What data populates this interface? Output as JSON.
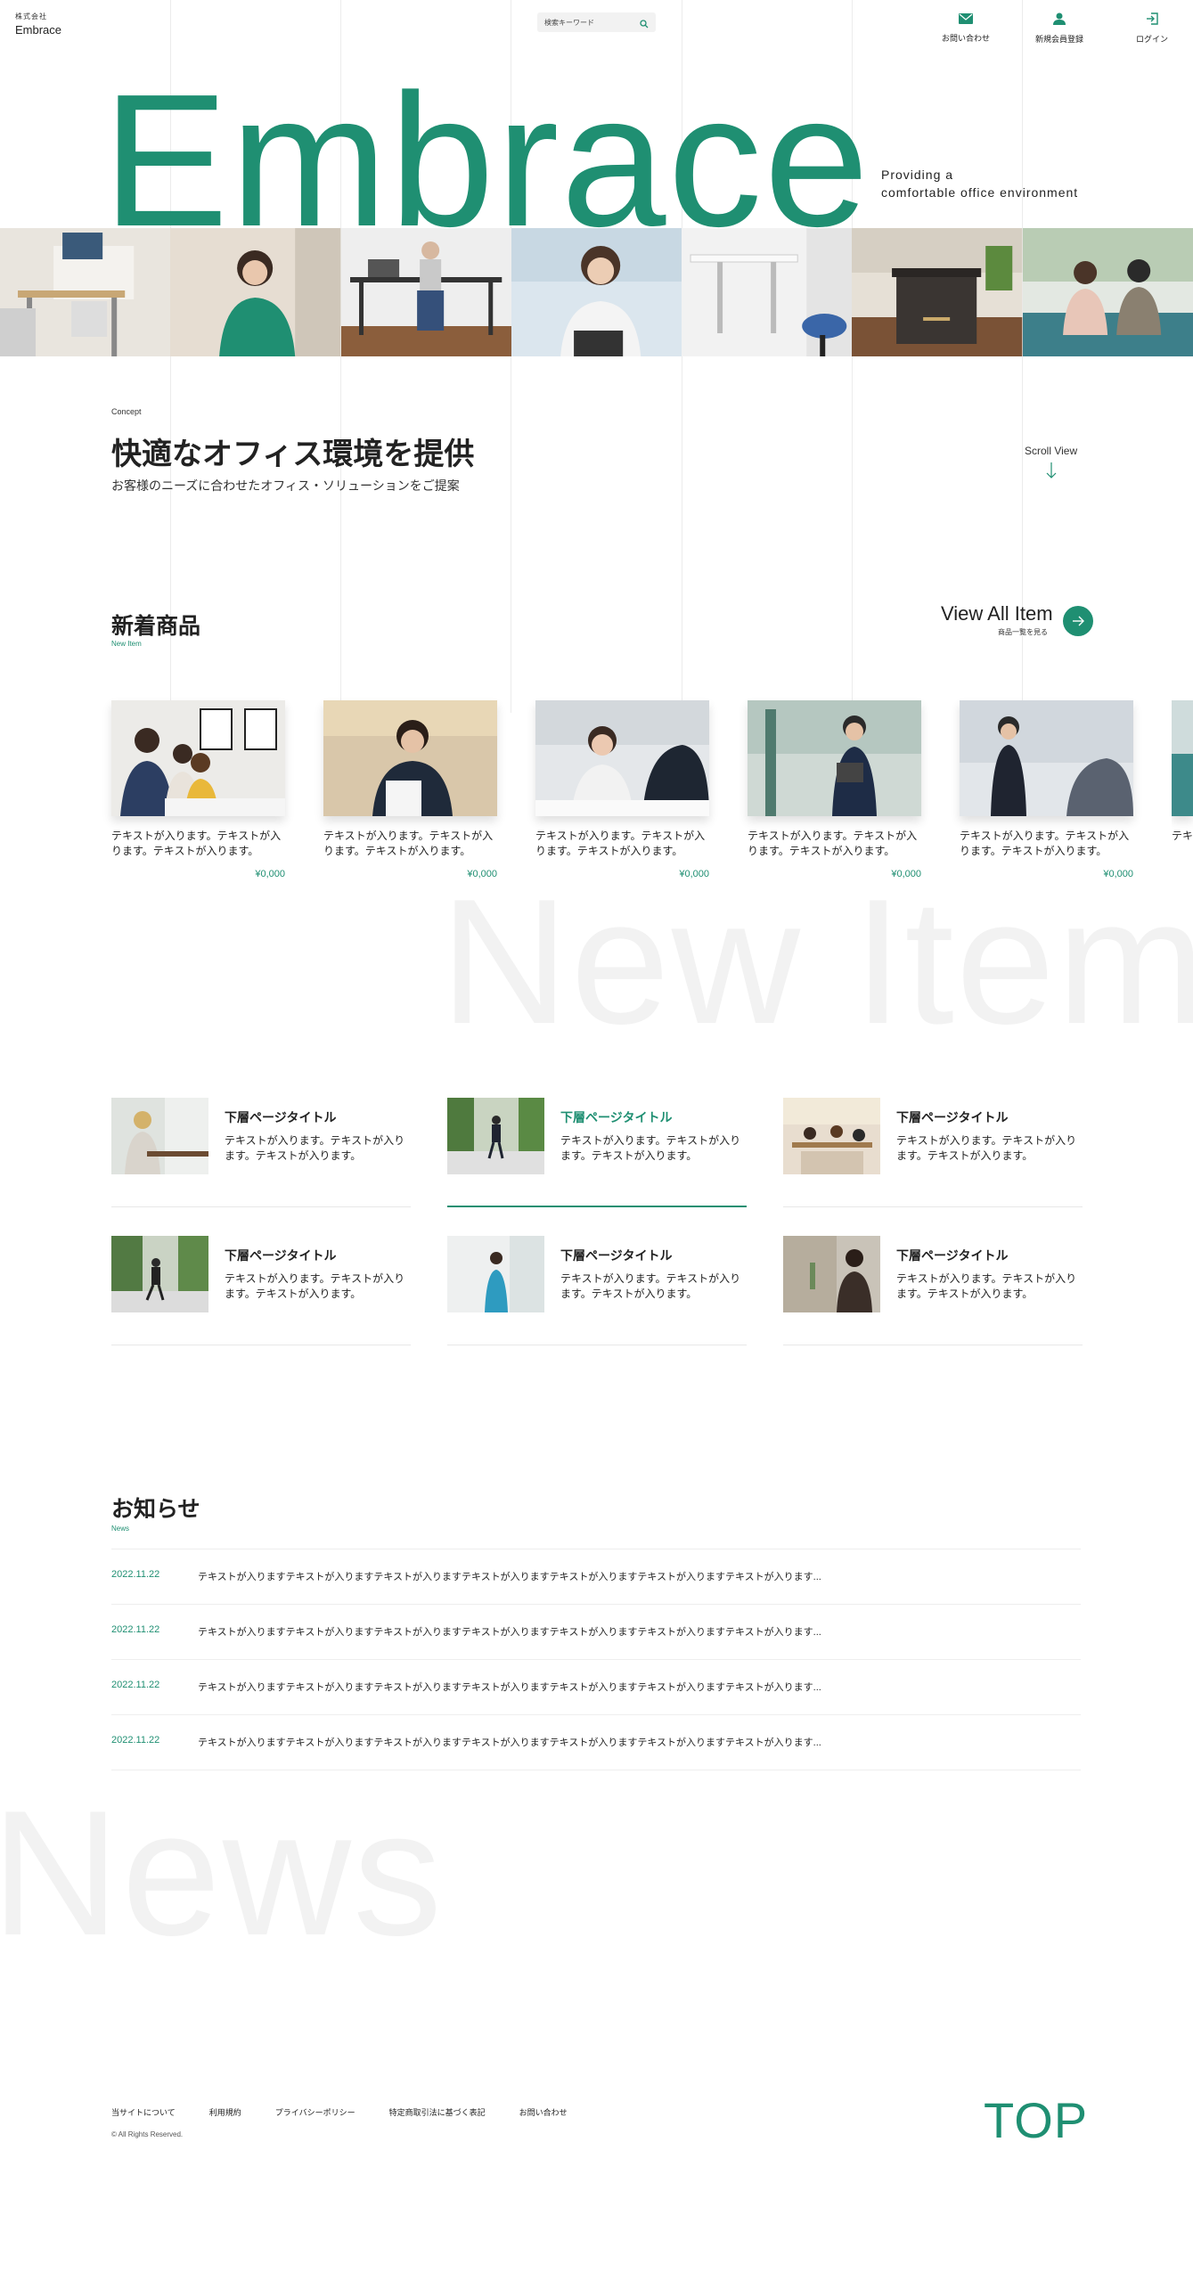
{
  "header": {
    "company_small": "株式会社",
    "logo": "Embrace",
    "search_placeholder": "検索キーワード",
    "nav": [
      {
        "label": "お問い合わせ",
        "icon": "mail-icon"
      },
      {
        "label": "新規会員登録",
        "icon": "user-icon"
      },
      {
        "label": "ログイン",
        "icon": "login-icon"
      }
    ]
  },
  "hero": {
    "title": "Embrace",
    "tagline_1": "Providing a",
    "tagline_2": "comfortable office environment"
  },
  "concept": {
    "label": "Concept",
    "title": "快適なオフィス環境を提供",
    "subtitle": "お客様のニーズに合わせたオフィス・ソリューションをご提案",
    "scroll": "Scroll View"
  },
  "new_items": {
    "title": "新着商品",
    "subtitle": "New Item",
    "view_all": "View All Item",
    "view_all_sub": "商品一覧を見る",
    "ghost": "New Item",
    "items": [
      {
        "text": "テキストが入ります。テキストが入ります。テキストが入ります。",
        "price": "¥0,000"
      },
      {
        "text": "テキストが入ります。テキストが入ります。テキストが入ります。",
        "price": "¥0,000"
      },
      {
        "text": "テキストが入ります。テキストが入ります。テキストが入ります。",
        "price": "¥0,000"
      },
      {
        "text": "テキストが入ります。テキストが入ります。テキストが入ります。",
        "price": "¥0,000"
      },
      {
        "text": "テキストが入ります。テキストが入ります。テキストが入ります。",
        "price": "¥0,000"
      },
      {
        "text": "テキ",
        "price": ""
      }
    ]
  },
  "sub_pages": [
    {
      "title": "下層ページタイトル",
      "text": "テキストが入ります。テキストが入ります。テキストが入ります。"
    },
    {
      "title": "下層ページタイトル",
      "text": "テキストが入ります。テキストが入ります。テキストが入ります。"
    },
    {
      "title": "下層ページタイトル",
      "text": "テキストが入ります。テキストが入ります。テキストが入ります。"
    },
    {
      "title": "下層ページタイトル",
      "text": "テキストが入ります。テキストが入ります。テキストが入ります。"
    },
    {
      "title": "下層ページタイトル",
      "text": "テキストが入ります。テキストが入ります。テキストが入ります。"
    },
    {
      "title": "下層ページタイトル",
      "text": "テキストが入ります。テキストが入ります。テキストが入ります。"
    }
  ],
  "news": {
    "title": "お知らせ",
    "subtitle": "News",
    "ghost": "News",
    "rows": [
      {
        "date": "2022.11.22",
        "text": "テキストが入りますテキストが入りますテキストが入りますテキストが入りますテキストが入りますテキストが入りますテキストが入ります..."
      },
      {
        "date": "2022.11.22",
        "text": "テキストが入りますテキストが入りますテキストが入りますテキストが入りますテキストが入りますテキストが入りますテキストが入ります..."
      },
      {
        "date": "2022.11.22",
        "text": "テキストが入りますテキストが入りますテキストが入りますテキストが入りますテキストが入りますテキストが入りますテキストが入ります..."
      },
      {
        "date": "2022.11.22",
        "text": "テキストが入りますテキストが入りますテキストが入りますテキストが入りますテキストが入りますテキストが入りますテキストが入ります..."
      }
    ]
  },
  "footer": {
    "links": [
      "当サイトについて",
      "利用規約",
      "プライバシーポリシー",
      "特定商取引法に基づく表記",
      "お問い合わせ"
    ],
    "copyright": "© All Rights Reserved.",
    "top": "TOP"
  },
  "colors": {
    "accent": "#1f8f72",
    "ghost": "#f2f2f2"
  }
}
